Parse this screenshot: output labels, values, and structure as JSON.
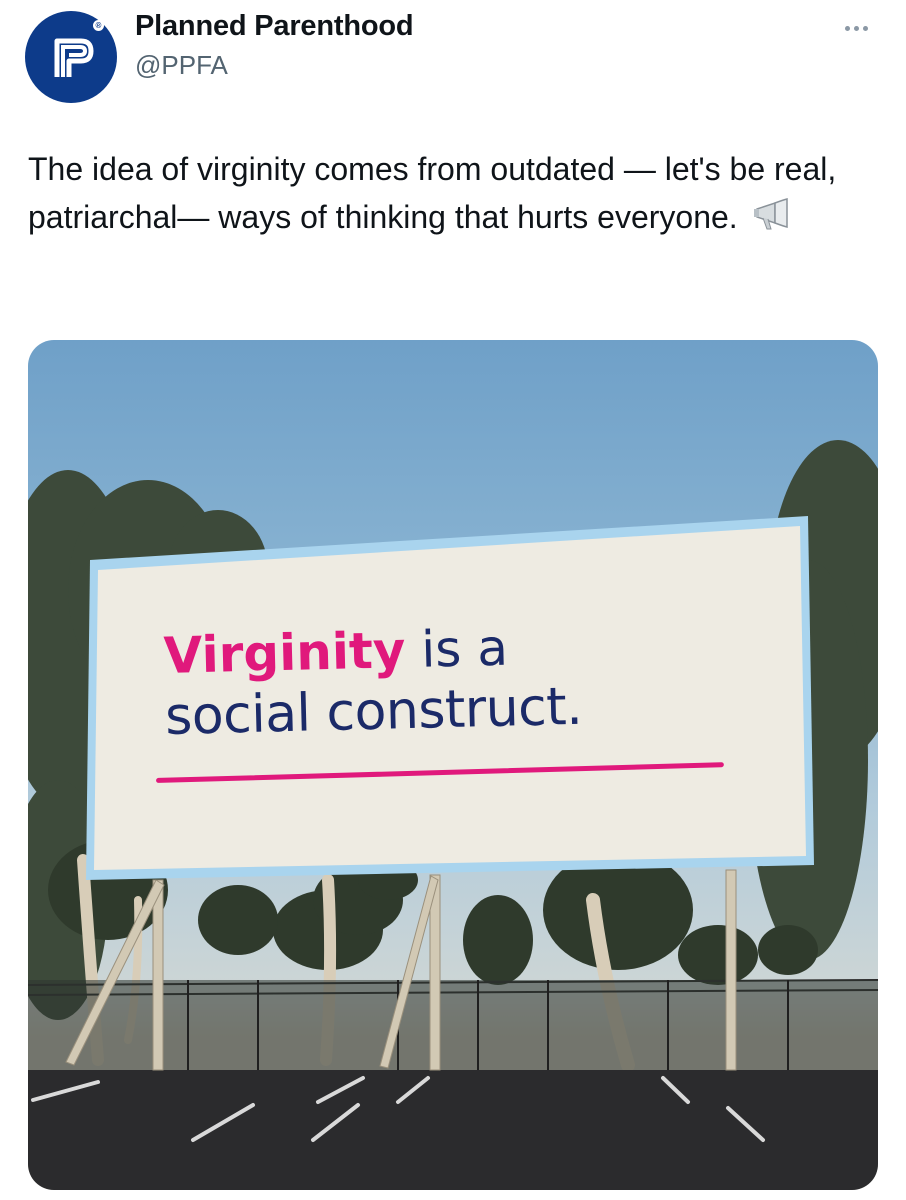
{
  "author": {
    "name": "Planned Parenthood",
    "handle": "@PPFA",
    "brand_color": "#0d3b8a"
  },
  "tweet": {
    "text": "The idea of virginity comes from outdated — let's be real, patriarchal— ways of thinking that hurts everyone.",
    "emoji_icon": "megaphone-icon"
  },
  "media": {
    "billboard": {
      "highlight": "Virginity",
      "line1_rest": " is a",
      "line2": "social construct.",
      "accent_color": "#e0197c",
      "text_color": "#1b2a68"
    }
  },
  "icons": {
    "more": "more-options-icon",
    "avatar": "planned-parenthood-logo"
  }
}
